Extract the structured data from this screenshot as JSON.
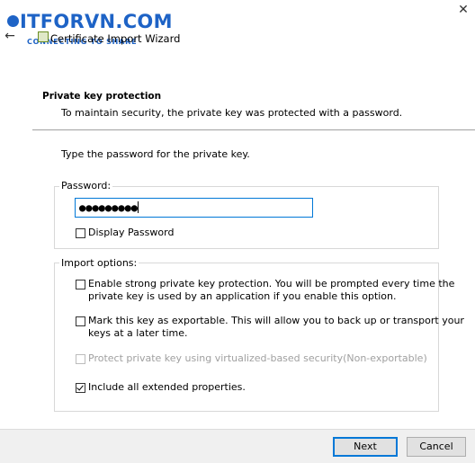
{
  "watermark": {
    "brand": "ITFORVN.COM",
    "tagline": "CONNECTING TO SHARE"
  },
  "window": {
    "title": "Certificate Import Wizard",
    "back_glyph": "←",
    "close_glyph": "✕"
  },
  "header": {
    "title": "Private key protection",
    "description": "To maintain security, the private key was protected with a password."
  },
  "instruction": "Type the password for the private key.",
  "password_group": {
    "label": "Password:",
    "value": "●●●●●●●●●",
    "display_password_label": "Display Password",
    "display_password_checked": false
  },
  "import_options": {
    "label": "Import options:",
    "options": [
      {
        "line1": "Enable strong private key protection. You will be prompted every time the",
        "line2": "private key is used by an application if you enable this option.",
        "checked": false,
        "enabled": true
      },
      {
        "line1": "Mark this key as exportable. This will allow you to back up or transport your",
        "line2": "keys at a later time.",
        "checked": false,
        "enabled": true
      },
      {
        "line1": "Protect private key using virtualized-based security(Non-exportable)",
        "line2": "",
        "checked": false,
        "enabled": false
      },
      {
        "line1": "Include all extended properties.",
        "line2": "",
        "checked": true,
        "enabled": true
      }
    ]
  },
  "buttons": {
    "next": "Next",
    "cancel": "Cancel"
  },
  "colors": {
    "accent": "#0078d7",
    "brand": "#1e63c6",
    "footer_bg": "#f0f0f0"
  }
}
